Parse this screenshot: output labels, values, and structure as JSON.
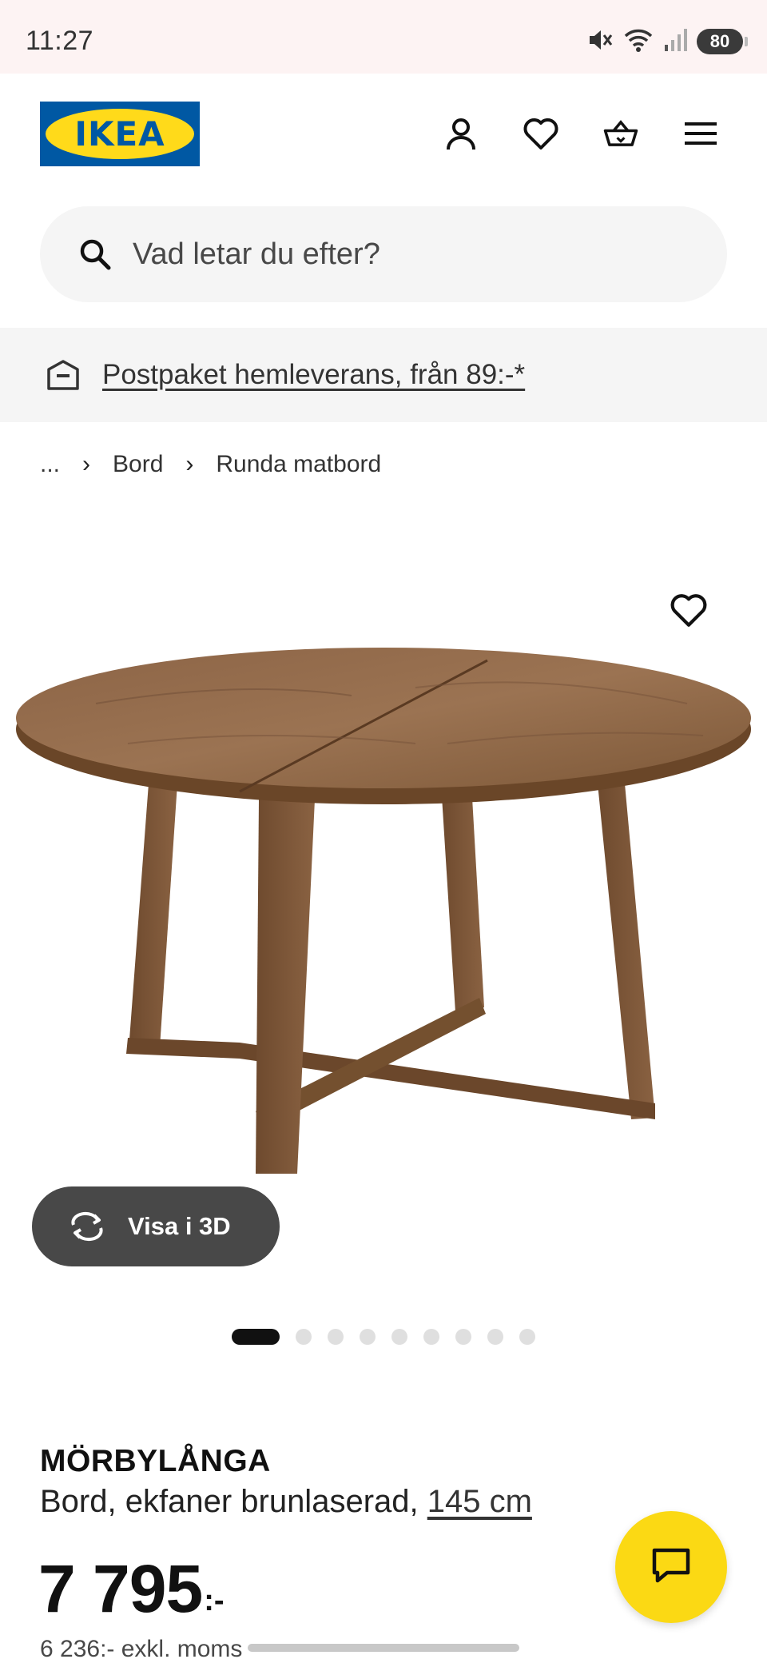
{
  "status_bar": {
    "time": "11:27",
    "battery": "80",
    "icons": [
      "mute-icon",
      "wifi-icon",
      "signal-icon",
      "battery-icon"
    ]
  },
  "header": {
    "logo_text": "IKEA",
    "icons": [
      "profile-icon",
      "favorites-icon",
      "basket-icon",
      "menu-icon"
    ]
  },
  "search": {
    "placeholder": "Vad letar du efter?"
  },
  "promo": {
    "text": "Postpaket hemleverans, från 89:-*"
  },
  "breadcrumb": {
    "items": [
      "...",
      "Bord",
      "Runda matbord"
    ]
  },
  "gallery": {
    "view_3d_label": "Visa i 3D",
    "image_count": 9,
    "active_index": 0
  },
  "product": {
    "name": "MÖRBYLÅNGA",
    "description": "Bord, ekfaner brunlaserad, ",
    "size": "145 cm",
    "price": "7 795",
    "price_suffix": ":-",
    "price_exkl": "6 236:- exkl. moms"
  },
  "colors": {
    "ikea_blue": "#0058a3",
    "ikea_yellow": "#ffda1a",
    "chat_yellow": "#fbd914",
    "dark_pill": "#484848"
  }
}
